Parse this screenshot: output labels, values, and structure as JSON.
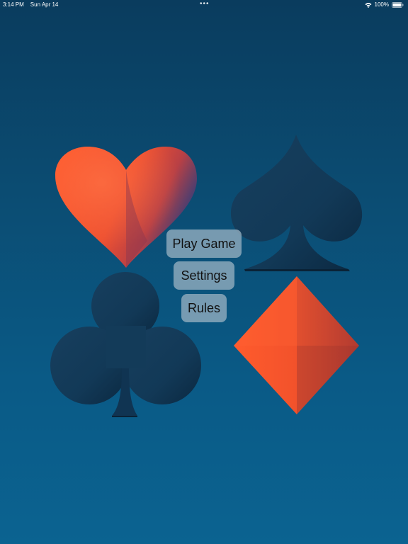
{
  "status_bar": {
    "time": "3:14 PM",
    "date": "Sun Apr 14",
    "dots": "•••",
    "battery": "100%"
  },
  "suits": {
    "icons": [
      "heart-icon",
      "spade-icon",
      "club-icon",
      "diamond-icon"
    ],
    "colors": {
      "red": "#ff5a2c",
      "red_shadow": "#b53a2f",
      "dark": "#123a57",
      "dark_shadow": "#0a2236"
    }
  },
  "menu": {
    "play_label": "Play Game",
    "settings_label": "Settings",
    "rules_label": "Rules"
  }
}
